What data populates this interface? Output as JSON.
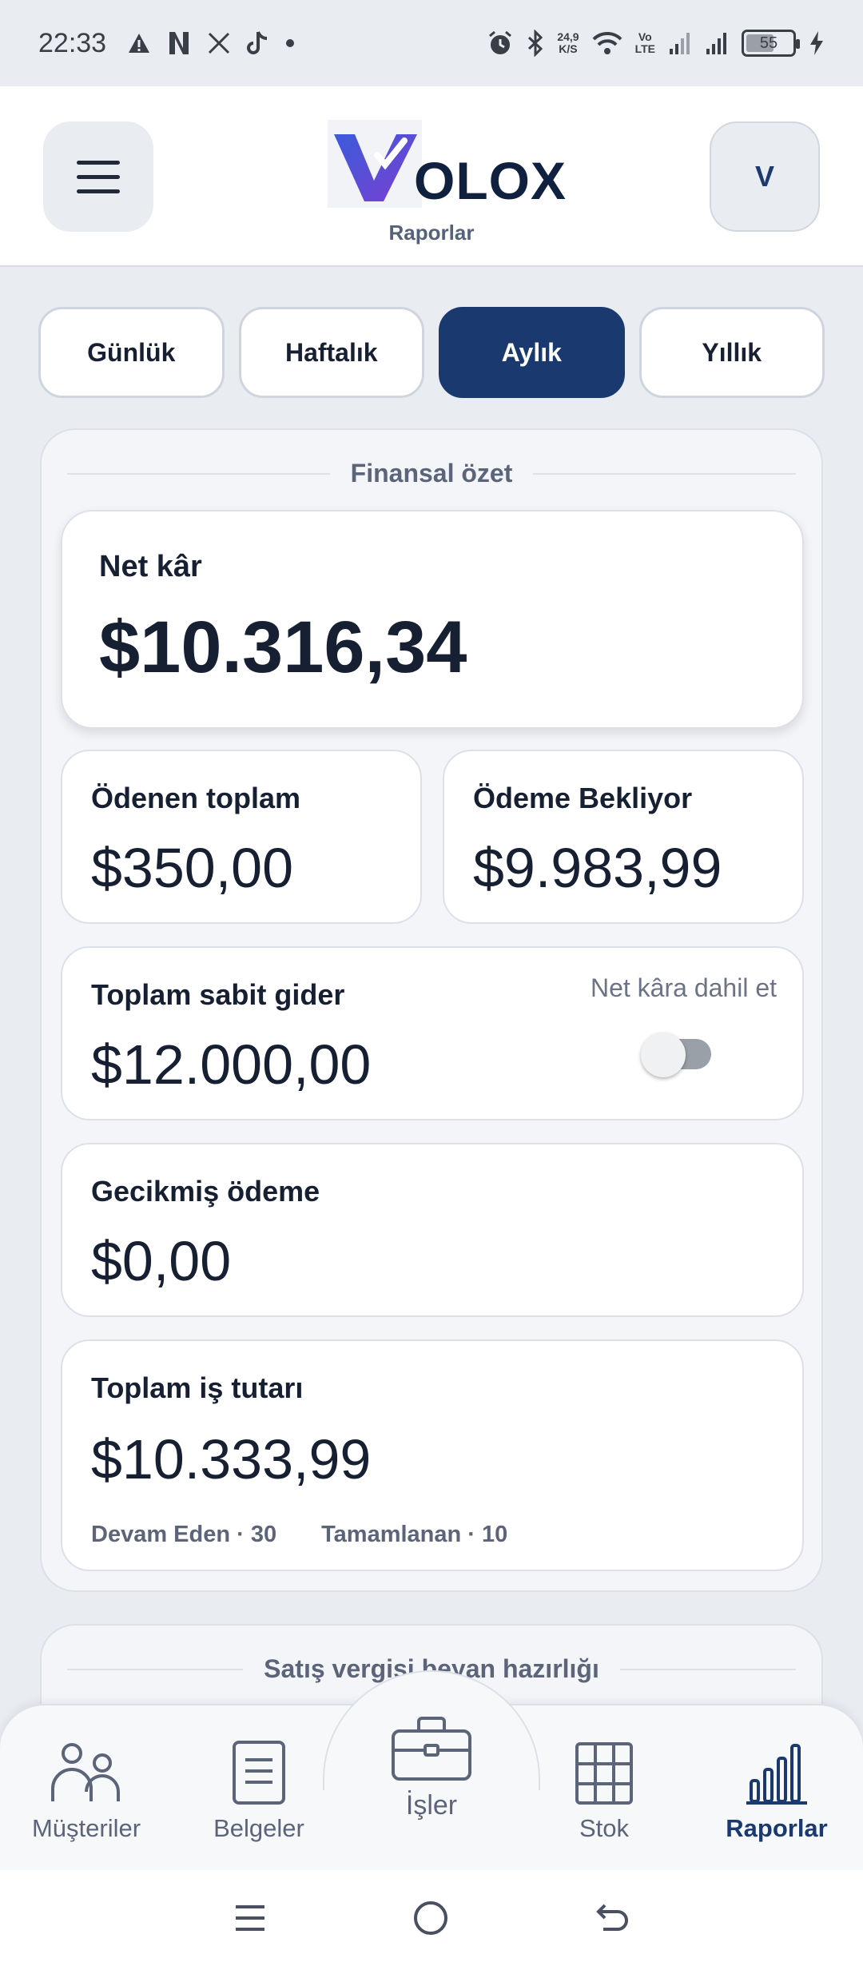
{
  "status_bar": {
    "time": "22:33",
    "left_icons": [
      "warning-icon",
      "netflix-icon",
      "x-icon",
      "tiktok-icon",
      "dot-icon"
    ],
    "speed_value": "24,9",
    "speed_unit": "K/S",
    "volte_top": "Vo",
    "volte_bottom": "LTE",
    "battery": "55"
  },
  "header": {
    "logo_text": "OLOX",
    "subtitle": "Raporlar",
    "avatar_letter": "V"
  },
  "tabs": [
    {
      "label": "Günlük",
      "active": false
    },
    {
      "label": "Haftalık",
      "active": false
    },
    {
      "label": "Aylık",
      "active": true
    },
    {
      "label": "Yıllık",
      "active": false
    }
  ],
  "summary": {
    "title": "Finansal özet",
    "net_profit": {
      "label": "Net kâr",
      "value": "$10.316,34"
    },
    "paid_total": {
      "label": "Ödenen toplam",
      "value": "$350,00"
    },
    "pending": {
      "label": "Ödeme Bekliyor",
      "value": "$9.983,99"
    },
    "fixed_expense": {
      "label": "Toplam sabit gider",
      "value": "$12.000,00",
      "toggle_label": "Net kâra dahil et",
      "toggle_on": false
    },
    "late_payment": {
      "label": "Gecikmiş ödeme",
      "value": "$0,00"
    },
    "total_jobs": {
      "label": "Toplam iş tutarı",
      "value": "$10.333,99",
      "ongoing": "Devam Eden · 30",
      "completed": "Tamamlanan · 10"
    }
  },
  "tax_section": {
    "title": "Satış vergisi beyan hazırlığı"
  },
  "bottom_nav": [
    {
      "label": "Müşteriler",
      "icon": "customers-icon",
      "active": false
    },
    {
      "label": "Belgeler",
      "icon": "document-icon",
      "active": false
    },
    {
      "label": "İşler",
      "icon": "briefcase-icon",
      "active": false
    },
    {
      "label": "Stok",
      "icon": "grid-icon",
      "active": false
    },
    {
      "label": "Raporlar",
      "icon": "bar-chart-icon",
      "active": true
    }
  ],
  "colors": {
    "primary": "#1a3a6f",
    "background": "#e9ecf1",
    "card": "#ffffff"
  }
}
